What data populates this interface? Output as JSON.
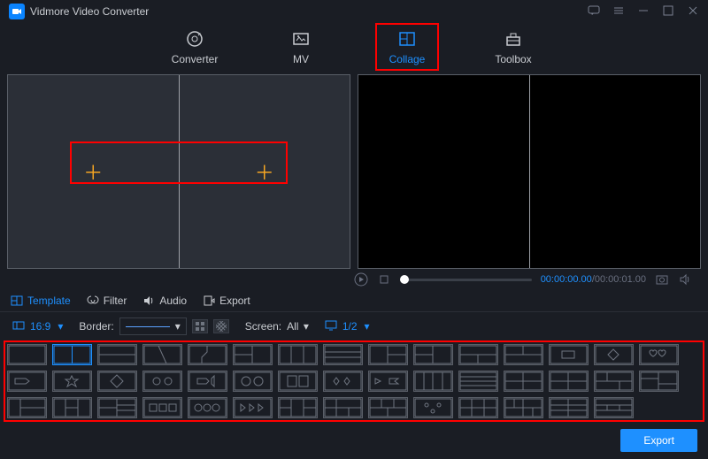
{
  "app": {
    "title": "Vidmore Video Converter"
  },
  "topnav": {
    "converter": "Converter",
    "mv": "MV",
    "collage": "Collage",
    "toolbox": "Toolbox"
  },
  "playbar": {
    "cur_time": "00:00:00.00",
    "total_time": "00:00:01.00"
  },
  "tabs": {
    "template": "Template",
    "filter": "Filter",
    "audio": "Audio",
    "export": "Export"
  },
  "options": {
    "aspect_value": "16:9",
    "border_label": "Border:",
    "screen_label": "Screen:",
    "screen_value": "All",
    "preview_value": "1/2"
  },
  "buttons": {
    "export": "Export"
  }
}
